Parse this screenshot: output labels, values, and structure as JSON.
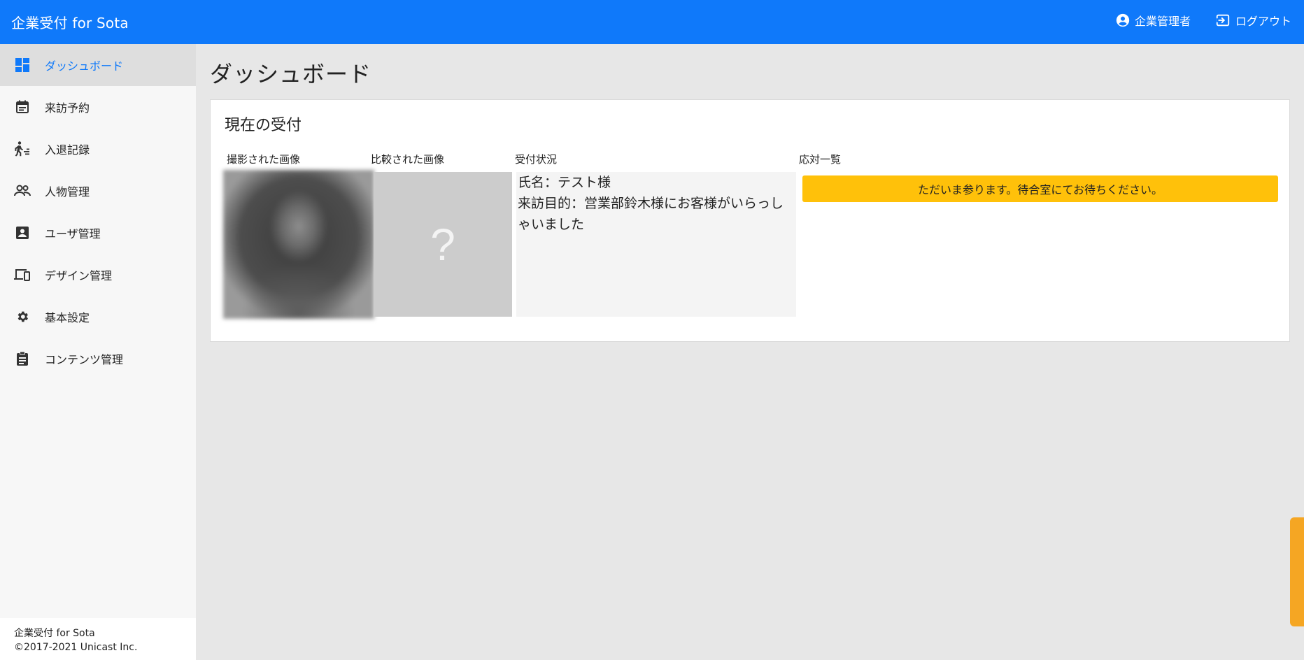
{
  "header": {
    "app_title": "企業受付 for Sota",
    "user_label": "企業管理者",
    "logout_label": "ログアウト",
    "bg_color": "#0f79fa"
  },
  "sidebar": {
    "items": [
      {
        "label": "ダッシュボード",
        "icon": "dashboard-icon",
        "active": true
      },
      {
        "label": "来訪予約",
        "icon": "calendar-icon"
      },
      {
        "label": "入退記録",
        "icon": "walking-person-icon"
      },
      {
        "label": "人物管理",
        "icon": "people-icon"
      },
      {
        "label": "ユーザ管理",
        "icon": "contact-card-icon"
      },
      {
        "label": "デザイン管理",
        "icon": "devices-icon"
      },
      {
        "label": "基本設定",
        "icon": "gear-icon"
      },
      {
        "label": "コンテンツ管理",
        "icon": "clipboard-icon"
      }
    ],
    "footer": {
      "line1": "企業受付 for Sota",
      "line2": "©2017-2021 Unicast Inc."
    }
  },
  "main": {
    "page_title": "ダッシュボード",
    "card": {
      "title": "現在の受付",
      "columns": {
        "captured": "撮影された画像",
        "compared": "比較された画像",
        "status": "受付状況",
        "responses": "応対一覧"
      },
      "compare_placeholder": "?",
      "status_lines": [
        "氏名：テスト様",
        "来訪目的：営業部鈴木様にお客様がいらっしゃいました"
      ],
      "response_buttons": [
        {
          "label": "ただいま参ります。待合室にてお待ちください。",
          "color": "#ffc10a"
        }
      ]
    }
  }
}
